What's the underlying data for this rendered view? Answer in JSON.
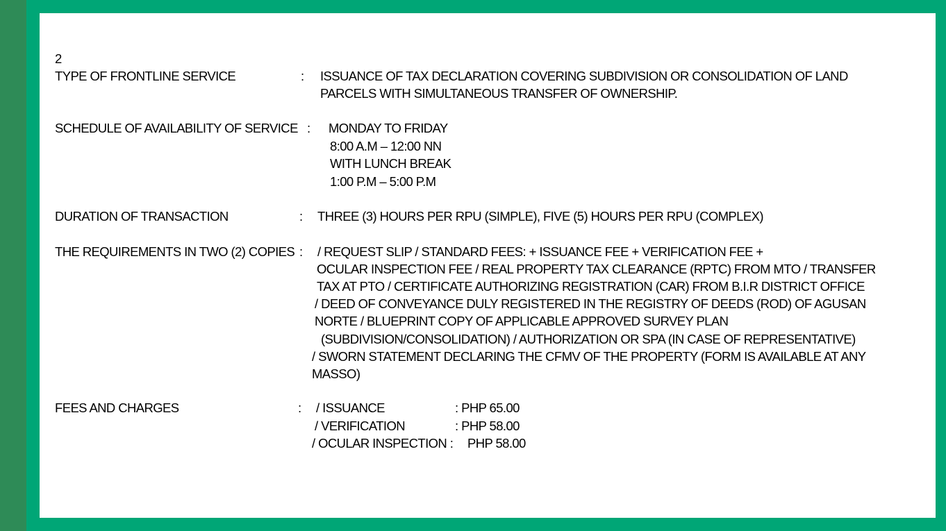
{
  "colors": {
    "frame": "#00a676",
    "side_stripe": "#2e8b57",
    "panel": "#ffffff",
    "text": "#000000"
  },
  "page_number": "2",
  "rows": {
    "service": {
      "label": "TYPE OF FRONTLINE SERVICE",
      "colon": ":",
      "lines": [
        "ISSUANCE OF TAX DECLARATION  COVERING SUBDIVISION OR CONSOLIDATION OF LAND",
        "PARCELS  WITH SIMULTANEOUS TRANSFER OF OWNERSHIP."
      ]
    },
    "schedule": {
      "label": "SCHEDULE OF AVAILABILITY OF SERVICE",
      "colon": ":",
      "lines": [
        "MONDAY TO FRIDAY",
        "8:00 A.M – 12:00 NN",
        "WITH LUNCH BREAK",
        "1:00 P.M – 5:00 P.M"
      ]
    },
    "duration": {
      "label": "DURATION OF TRANSACTION",
      "colon": ":",
      "lines": [
        "THREE (3) HOURS PER RPU (SIMPLE), FIVE (5) HOURS PER RPU (COMPLEX)"
      ]
    },
    "requirements": {
      "label": "THE REQUIREMENTS IN TWO (2) COPIES",
      "colon": ":",
      "lines": [
        "/   REQUEST SLIP /   STANDARD FEES: +   ISSUANCE FEE +   VERIFICATION FEE +",
        "OCULAR INSPECTION FEE /   REAL PROPERTY TAX CLEARANCE (RPTC) FROM MTO /   TRANSFER",
        "TAX AT PTO /   CERTIFICATE AUTHORIZING REGISTRATION (CAR) FROM B.I.R DISTRICT OFFICE",
        "/   DEED OF CONVEYANCE DULY REGISTERED IN THE REGISTRY OF DEEDS (ROD) OF AGUSAN",
        "NORTE /   BLUEPRINT COPY OF APPLICABLE  APPROVED SURVEY PLAN",
        "(SUBDIVISION/CONSOLIDATION) /   AUTHORIZATION OR SPA (IN CASE OF REPRESENTATIVE)",
        "/   SWORN STATEMENT DECLARING THE CFMV OF THE PROPERTY (FORM IS AVAILABLE AT ANY",
        "MASSO)"
      ]
    },
    "fees": {
      "label": "FEES AND CHARGES",
      "colon": ":",
      "items": [
        {
          "name": "/   ISSUANCE",
          "value": ": PHP 65.00"
        },
        {
          "name": "/   VERIFICATION",
          "value": ": PHP 58.00"
        },
        {
          "name": "/   OCULAR INSPECTION :",
          "value": "PHP 58.00"
        }
      ]
    }
  }
}
